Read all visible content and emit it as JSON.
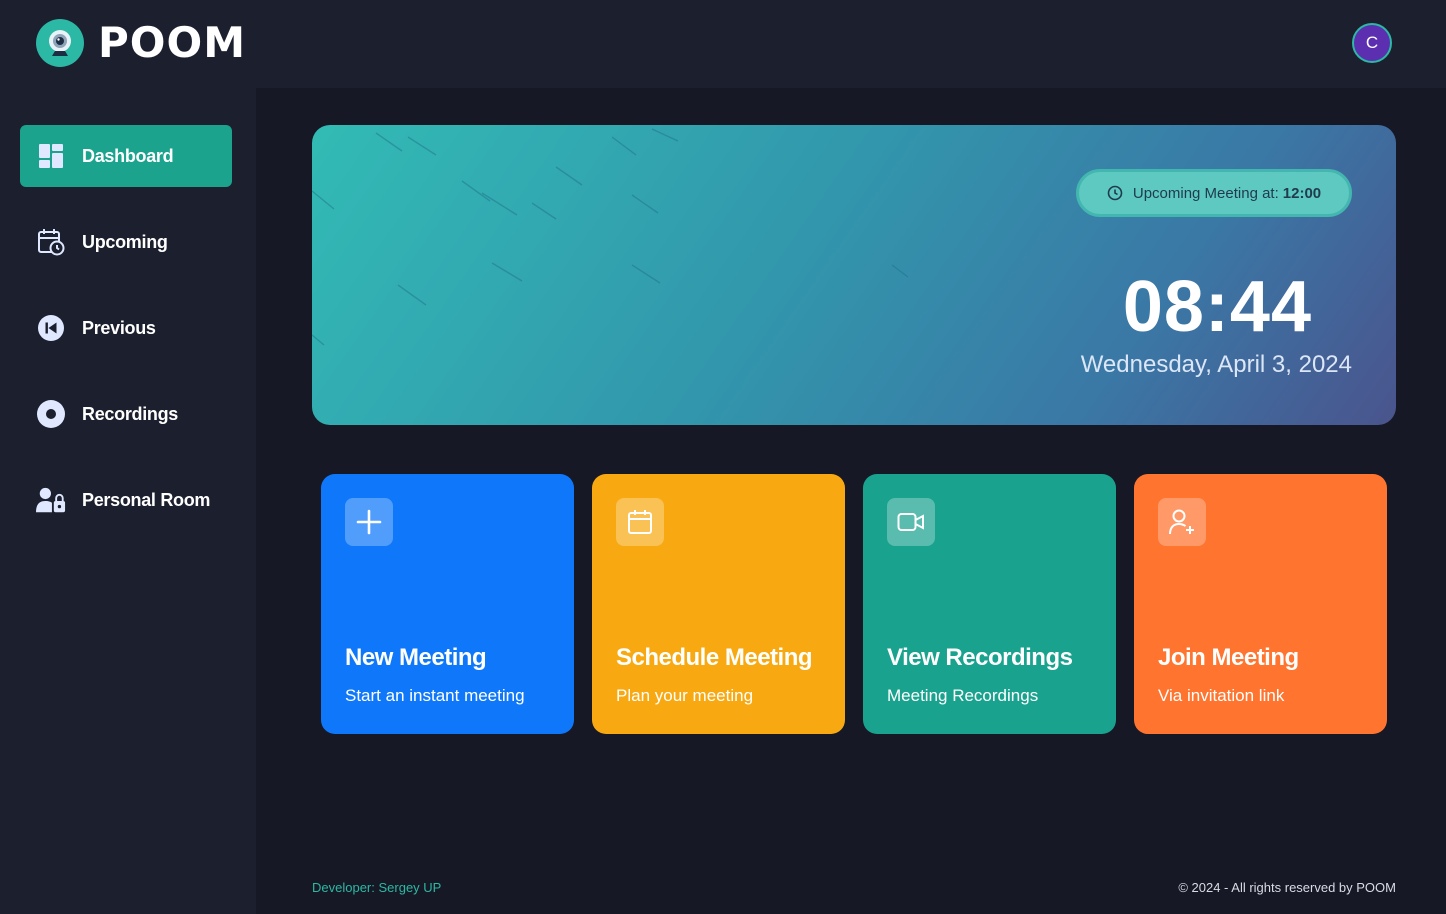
{
  "app": {
    "name": "POOM",
    "avatar_letter": "C"
  },
  "sidebar": {
    "items": [
      {
        "label": "Dashboard",
        "icon": "dashboard-icon",
        "active": true
      },
      {
        "label": "Upcoming",
        "icon": "calendar-clock-icon",
        "active": false
      },
      {
        "label": "Previous",
        "icon": "previous-icon",
        "active": false
      },
      {
        "label": "Recordings",
        "icon": "record-icon",
        "active": false
      },
      {
        "label": "Personal Room",
        "icon": "user-lock-icon",
        "active": false
      }
    ]
  },
  "hero": {
    "upcoming_label": "Upcoming Meeting at:",
    "upcoming_time": "12:00",
    "time": "08:44",
    "date": "Wednesday, April 3, 2024"
  },
  "cards": [
    {
      "title": "New Meeting",
      "subtitle": "Start an instant meeting",
      "icon": "plus-icon",
      "color": "#0f78fa"
    },
    {
      "title": "Schedule Meeting",
      "subtitle": "Plan your meeting",
      "icon": "calendar-icon",
      "color": "#f8a912"
    },
    {
      "title": "View Recordings",
      "subtitle": "Meeting Recordings",
      "icon": "video-icon",
      "color": "#19a38f"
    },
    {
      "title": "Join Meeting",
      "subtitle": "Via invitation link",
      "icon": "user-add-icon",
      "color": "#ff742e"
    }
  ],
  "footer": {
    "developer": "Developer: Sergey UP",
    "copyright": "© 2024 - All rights reserved by POOM"
  },
  "colors": {
    "accent": "#1ba38e",
    "background": "#161925",
    "panel": "#1c1f2e"
  }
}
